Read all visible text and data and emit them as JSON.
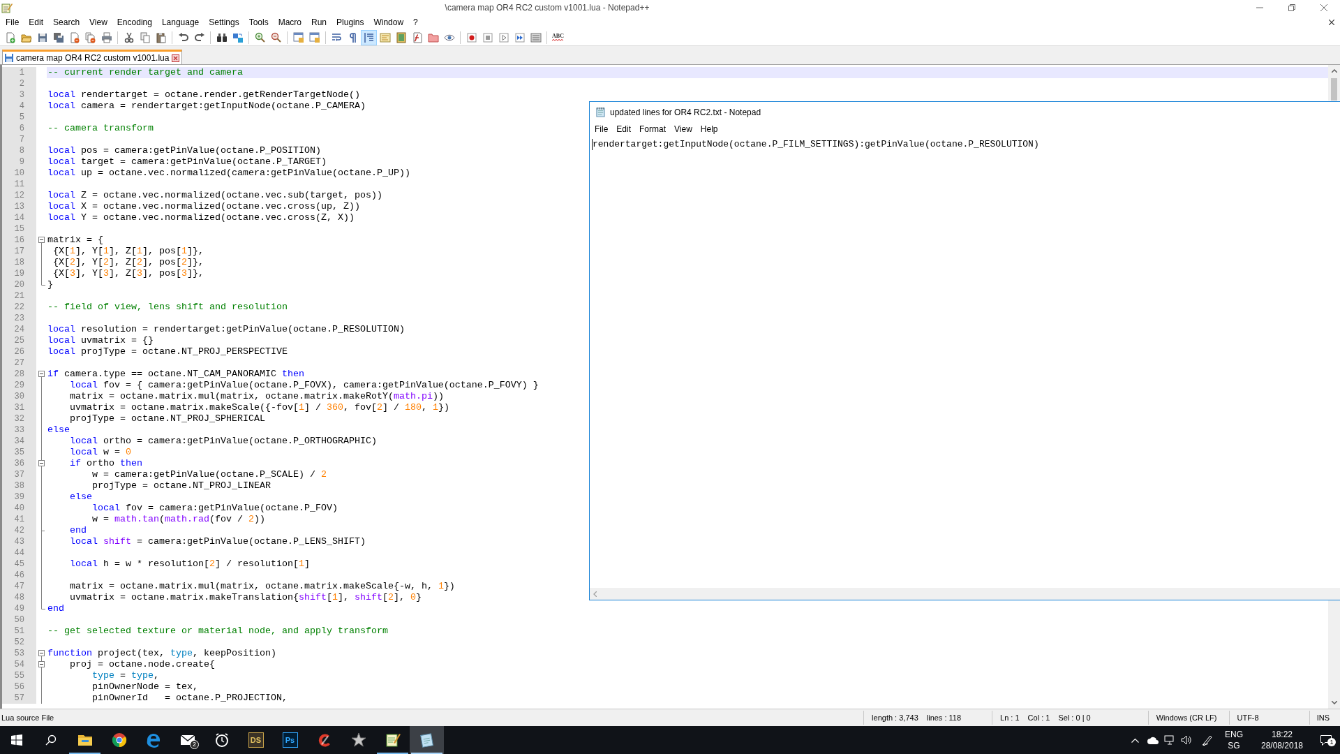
{
  "window": {
    "title": "\\camera map OR4 RC2 custom v1001.lua - Notepad++"
  },
  "menu": [
    "File",
    "Edit",
    "Search",
    "View",
    "Encoding",
    "Language",
    "Settings",
    "Tools",
    "Macro",
    "Run",
    "Plugins",
    "Window",
    "?"
  ],
  "toolbar": [
    {
      "kind": "new",
      "pressed": false
    },
    {
      "kind": "open",
      "pressed": false
    },
    {
      "kind": "save",
      "pressed": false
    },
    {
      "kind": "save_all",
      "pressed": false
    },
    {
      "kind": "close",
      "pressed": false
    },
    {
      "kind": "close_all",
      "pressed": false
    },
    {
      "kind": "print",
      "pressed": false
    },
    {
      "kind": "separator"
    },
    {
      "kind": "cut",
      "pressed": false
    },
    {
      "kind": "copy",
      "pressed": false
    },
    {
      "kind": "paste",
      "pressed": false
    },
    {
      "kind": "separator"
    },
    {
      "kind": "undo",
      "pressed": false
    },
    {
      "kind": "redo",
      "pressed": false
    },
    {
      "kind": "separator"
    },
    {
      "kind": "find",
      "pressed": false
    },
    {
      "kind": "replace",
      "pressed": false
    },
    {
      "kind": "separator"
    },
    {
      "kind": "zoom_in",
      "pressed": false
    },
    {
      "kind": "zoom_out",
      "pressed": false
    },
    {
      "kind": "separator"
    },
    {
      "kind": "sync_v",
      "pressed": false
    },
    {
      "kind": "sync_h",
      "pressed": false
    },
    {
      "kind": "separator"
    },
    {
      "kind": "wrap",
      "pressed": false
    },
    {
      "kind": "all_chars",
      "pressed": false
    },
    {
      "kind": "indent_guide",
      "pressed": true
    },
    {
      "kind": "udl",
      "pressed": false
    },
    {
      "kind": "doc_map",
      "pressed": false
    },
    {
      "kind": "func_list",
      "pressed": false
    },
    {
      "kind": "folder",
      "pressed": false
    },
    {
      "kind": "monitor",
      "pressed": false
    },
    {
      "kind": "separator"
    },
    {
      "kind": "record",
      "pressed": false
    },
    {
      "kind": "stop",
      "pressed": false
    },
    {
      "kind": "play",
      "pressed": false
    },
    {
      "kind": "play_multi",
      "pressed": false
    },
    {
      "kind": "save_macro",
      "pressed": false
    },
    {
      "kind": "separator"
    },
    {
      "kind": "spell",
      "pressed": false,
      "label": "ABC"
    }
  ],
  "tabs": [
    {
      "label": "camera map OR4 RC2 custom v1001.lua",
      "selected": true
    }
  ],
  "editor": {
    "lines": [
      {
        "number": "1",
        "current": true,
        "kind": "plain",
        "tokens": [
          {
            "kind": "comment",
            "text": "-- current render target and camera"
          }
        ]
      },
      {
        "number": "2",
        "current": false,
        "kind": "plain"
      },
      {
        "number": "3",
        "current": false,
        "kind": "plain",
        "tokens": [
          {
            "kind": "keyword",
            "text": "local"
          },
          {
            "kind": "plain",
            "text": " rendertarget = octane.render.getRenderTargetNode()"
          }
        ]
      },
      {
        "number": "4",
        "current": false,
        "kind": "plain",
        "tokens": [
          {
            "kind": "keyword",
            "text": "local"
          },
          {
            "kind": "plain",
            "text": " camera = rendertarget:getInputNode(octane.P_CAMERA)"
          }
        ]
      },
      {
        "number": "5",
        "current": false,
        "kind": "plain"
      },
      {
        "number": "6",
        "current": false,
        "kind": "plain",
        "tokens": [
          {
            "kind": "comment",
            "text": "-- camera transform"
          }
        ]
      },
      {
        "number": "7",
        "current": false,
        "kind": "plain"
      },
      {
        "number": "8",
        "current": false,
        "kind": "plain",
        "tokens": [
          {
            "kind": "keyword",
            "text": "local"
          },
          {
            "kind": "plain",
            "text": " pos = camera:getPinValue(octane.P_POSITION)"
          }
        ]
      },
      {
        "number": "9",
        "current": false,
        "kind": "plain",
        "tokens": [
          {
            "kind": "keyword",
            "text": "local"
          },
          {
            "kind": "plain",
            "text": " target = camera:getPinValue(octane.P_TARGET)"
          }
        ]
      },
      {
        "number": "10",
        "current": false,
        "kind": "plain",
        "tokens": [
          {
            "kind": "keyword",
            "text": "local"
          },
          {
            "kind": "plain",
            "text": " up = octane.vec.normalized(camera:getPinValue(octane.P_UP))"
          }
        ]
      },
      {
        "number": "11",
        "current": false,
        "kind": "plain"
      },
      {
        "number": "12",
        "current": false,
        "kind": "plain",
        "tokens": [
          {
            "kind": "keyword",
            "text": "local"
          },
          {
            "kind": "plain",
            "text": " Z = octane.vec.normalized(octane.vec.sub(target, pos))"
          }
        ]
      },
      {
        "number": "13",
        "current": false,
        "kind": "plain",
        "tokens": [
          {
            "kind": "keyword",
            "text": "local"
          },
          {
            "kind": "plain",
            "text": " X = octane.vec.normalized(octane.vec.cross(up, Z))"
          }
        ]
      },
      {
        "number": "14",
        "current": false,
        "kind": "plain",
        "tokens": [
          {
            "kind": "keyword",
            "text": "local"
          },
          {
            "kind": "plain",
            "text": " Y = octane.vec.normalized(octane.vec.cross(Z, X))"
          }
        ]
      },
      {
        "number": "15",
        "current": false,
        "kind": "plain"
      },
      {
        "number": "16",
        "current": false,
        "kind": "fold_start",
        "tokens": [
          {
            "kind": "plain",
            "text": "matrix = {"
          }
        ]
      },
      {
        "number": "17",
        "current": false,
        "kind": "fold_body",
        "tokens": [
          {
            "kind": "plain",
            "text": " {X["
          },
          {
            "kind": "number",
            "text": "1"
          },
          {
            "kind": "plain",
            "text": "], Y["
          },
          {
            "kind": "number",
            "text": "1"
          },
          {
            "kind": "plain",
            "text": "], Z["
          },
          {
            "kind": "number",
            "text": "1"
          },
          {
            "kind": "plain",
            "text": "], pos["
          },
          {
            "kind": "number",
            "text": "1"
          },
          {
            "kind": "plain",
            "text": "]},"
          }
        ]
      },
      {
        "number": "18",
        "current": false,
        "kind": "fold_body",
        "tokens": [
          {
            "kind": "plain",
            "text": " {X["
          },
          {
            "kind": "number",
            "text": "2"
          },
          {
            "kind": "plain",
            "text": "], Y["
          },
          {
            "kind": "number",
            "text": "2"
          },
          {
            "kind": "plain",
            "text": "], Z["
          },
          {
            "kind": "number",
            "text": "2"
          },
          {
            "kind": "plain",
            "text": "], pos["
          },
          {
            "kind": "number",
            "text": "2"
          },
          {
            "kind": "plain",
            "text": "]},"
          }
        ]
      },
      {
        "number": "19",
        "current": false,
        "kind": "fold_body",
        "tokens": [
          {
            "kind": "plain",
            "text": " {X["
          },
          {
            "kind": "number",
            "text": "3"
          },
          {
            "kind": "plain",
            "text": "], Y["
          },
          {
            "kind": "number",
            "text": "3"
          },
          {
            "kind": "plain",
            "text": "], Z["
          },
          {
            "kind": "number",
            "text": "3"
          },
          {
            "kind": "plain",
            "text": "], pos["
          },
          {
            "kind": "number",
            "text": "3"
          },
          {
            "kind": "plain",
            "text": "]},"
          }
        ]
      },
      {
        "number": "20",
        "current": false,
        "kind": "fold_end",
        "tokens": [
          {
            "kind": "plain",
            "text": "}"
          }
        ]
      },
      {
        "number": "21",
        "current": false,
        "kind": "plain"
      },
      {
        "number": "22",
        "current": false,
        "kind": "plain",
        "tokens": [
          {
            "kind": "comment",
            "text": "-- field of view, lens shift and resolution"
          }
        ]
      },
      {
        "number": "23",
        "current": false,
        "kind": "plain"
      },
      {
        "number": "24",
        "current": false,
        "kind": "plain",
        "tokens": [
          {
            "kind": "keyword",
            "text": "local"
          },
          {
            "kind": "plain",
            "text": " resolution = rendertarget:getPinValue(octane.P_RESOLUTION)"
          }
        ]
      },
      {
        "number": "25",
        "current": false,
        "kind": "plain",
        "tokens": [
          {
            "kind": "keyword",
            "text": "local"
          },
          {
            "kind": "plain",
            "text": " uvmatrix = {}"
          }
        ]
      },
      {
        "number": "26",
        "current": false,
        "kind": "plain",
        "tokens": [
          {
            "kind": "keyword",
            "text": "local"
          },
          {
            "kind": "plain",
            "text": " projType = octane.NT_PROJ_PERSPECTIVE"
          }
        ]
      },
      {
        "number": "27",
        "current": false,
        "kind": "plain"
      },
      {
        "number": "28",
        "current": false,
        "kind": "fold_start",
        "tokens": [
          {
            "kind": "keyword",
            "text": "if"
          },
          {
            "kind": "plain",
            "text": " camera.type == octane.NT_CAM_PANORAMIC "
          },
          {
            "kind": "keyword",
            "text": "then"
          }
        ]
      },
      {
        "number": "29",
        "current": false,
        "kind": "fold_body",
        "tokens": [
          {
            "kind": "keyword",
            "text": "    local"
          },
          {
            "kind": "plain",
            "text": " fov = { camera:getPinValue(octane.P_FOVX), camera:getPinValue(octane.P_FOVY) }"
          }
        ]
      },
      {
        "number": "30",
        "current": false,
        "kind": "fold_body",
        "tokens": [
          {
            "kind": "plain",
            "text": "    matrix = octane.matrix.mul(matrix, octane.matrix.makeRotY("
          },
          {
            "kind": "library",
            "text": "math.pi"
          },
          {
            "kind": "plain",
            "text": "))"
          }
        ]
      },
      {
        "number": "31",
        "current": false,
        "kind": "fold_body",
        "tokens": [
          {
            "kind": "plain",
            "text": "    uvmatrix = octane.matrix.makeScale({-fov["
          },
          {
            "kind": "number",
            "text": "1"
          },
          {
            "kind": "plain",
            "text": "] / "
          },
          {
            "kind": "number",
            "text": "360"
          },
          {
            "kind": "plain",
            "text": ", fov["
          },
          {
            "kind": "number",
            "text": "2"
          },
          {
            "kind": "plain",
            "text": "] / "
          },
          {
            "kind": "number",
            "text": "180"
          },
          {
            "kind": "plain",
            "text": ", "
          },
          {
            "kind": "number",
            "text": "1"
          },
          {
            "kind": "plain",
            "text": "})"
          }
        ]
      },
      {
        "number": "32",
        "current": false,
        "kind": "fold_body",
        "tokens": [
          {
            "kind": "plain",
            "text": "    projType = octane.NT_PROJ_SPHERICAL"
          }
        ]
      },
      {
        "number": "33",
        "current": false,
        "kind": "fold_body",
        "tokens": [
          {
            "kind": "keyword",
            "text": "else"
          }
        ]
      },
      {
        "number": "34",
        "current": false,
        "kind": "fold_body",
        "tokens": [
          {
            "kind": "keyword",
            "text": "    local"
          },
          {
            "kind": "plain",
            "text": " ortho = camera:getPinValue(octane.P_ORTHOGRAPHIC)"
          }
        ]
      },
      {
        "number": "35",
        "current": false,
        "kind": "fold_body",
        "tokens": [
          {
            "kind": "keyword",
            "text": "    local"
          },
          {
            "kind": "plain",
            "text": " w = "
          },
          {
            "kind": "number",
            "text": "0"
          }
        ]
      },
      {
        "number": "36",
        "current": false,
        "kind": "fold_inner_start",
        "tokens": [
          {
            "kind": "keyword",
            "text": "    if"
          },
          {
            "kind": "plain",
            "text": " ortho "
          },
          {
            "kind": "keyword",
            "text": "then"
          }
        ]
      },
      {
        "number": "37",
        "current": false,
        "kind": "fold_body",
        "tokens": [
          {
            "kind": "plain",
            "text": "        w = camera:getPinValue(octane.P_SCALE) / "
          },
          {
            "kind": "number",
            "text": "2"
          }
        ]
      },
      {
        "number": "38",
        "current": false,
        "kind": "fold_body",
        "tokens": [
          {
            "kind": "plain",
            "text": "        projType = octane.NT_PROJ_LINEAR"
          }
        ]
      },
      {
        "number": "39",
        "current": false,
        "kind": "fold_body",
        "tokens": [
          {
            "kind": "keyword",
            "text": "    else"
          }
        ]
      },
      {
        "number": "40",
        "current": false,
        "kind": "fold_body",
        "tokens": [
          {
            "kind": "keyword",
            "text": "        local"
          },
          {
            "kind": "plain",
            "text": " fov = camera:getPinValue(octane.P_FOV)"
          }
        ]
      },
      {
        "number": "41",
        "current": false,
        "kind": "fold_body",
        "tokens": [
          {
            "kind": "plain",
            "text": "        w = "
          },
          {
            "kind": "library",
            "text": "math.tan"
          },
          {
            "kind": "plain",
            "text": "("
          },
          {
            "kind": "library",
            "text": "math.rad"
          },
          {
            "kind": "plain",
            "text": "(fov / "
          },
          {
            "kind": "number",
            "text": "2"
          },
          {
            "kind": "plain",
            "text": "))"
          }
        ]
      },
      {
        "number": "42",
        "current": false,
        "kind": "fold_inner_end",
        "tokens": [
          {
            "kind": "keyword",
            "text": "    end"
          }
        ]
      },
      {
        "number": "43",
        "current": false,
        "kind": "fold_body",
        "tokens": [
          {
            "kind": "keyword",
            "text": "    local"
          },
          {
            "kind": "library",
            "text": " shift"
          },
          {
            "kind": "plain",
            "text": " = camera:getPinValue(octane.P_LENS_SHIFT)"
          }
        ]
      },
      {
        "number": "44",
        "current": false,
        "kind": "fold_body"
      },
      {
        "number": "45",
        "current": false,
        "kind": "fold_body",
        "tokens": [
          {
            "kind": "keyword",
            "text": "    local"
          },
          {
            "kind": "plain",
            "text": " h = w * resolution["
          },
          {
            "kind": "number",
            "text": "2"
          },
          {
            "kind": "plain",
            "text": "] / resolution["
          },
          {
            "kind": "number",
            "text": "1"
          },
          {
            "kind": "plain",
            "text": "]"
          }
        ]
      },
      {
        "number": "46",
        "current": false,
        "kind": "fold_body"
      },
      {
        "number": "47",
        "current": false,
        "kind": "fold_body",
        "tokens": [
          {
            "kind": "plain",
            "text": "    matrix = octane.matrix.mul(matrix, octane.matrix.makeScale{-w, h, "
          },
          {
            "kind": "number",
            "text": "1"
          },
          {
            "kind": "plain",
            "text": "})"
          }
        ]
      },
      {
        "number": "48",
        "current": false,
        "kind": "fold_body",
        "tokens": [
          {
            "kind": "plain",
            "text": "    uvmatrix = octane.matrix.makeTranslation{"
          },
          {
            "kind": "library",
            "text": "shift"
          },
          {
            "kind": "plain",
            "text": "["
          },
          {
            "kind": "number",
            "text": "1"
          },
          {
            "kind": "plain",
            "text": "], "
          },
          {
            "kind": "library",
            "text": "shift"
          },
          {
            "kind": "plain",
            "text": "["
          },
          {
            "kind": "number",
            "text": "2"
          },
          {
            "kind": "plain",
            "text": "], "
          },
          {
            "kind": "number",
            "text": "0"
          },
          {
            "kind": "plain",
            "text": "}"
          }
        ]
      },
      {
        "number": "49",
        "current": false,
        "kind": "fold_end",
        "tokens": [
          {
            "kind": "keyword",
            "text": "end"
          }
        ]
      },
      {
        "number": "50",
        "current": false,
        "kind": "plain"
      },
      {
        "number": "51",
        "current": false,
        "kind": "plain",
        "tokens": [
          {
            "kind": "comment",
            "text": "-- get selected texture or material node, and apply transform"
          }
        ]
      },
      {
        "number": "52",
        "current": false,
        "kind": "plain"
      },
      {
        "number": "53",
        "current": false,
        "kind": "fold_start",
        "tokens": [
          {
            "kind": "keyword",
            "text": "function"
          },
          {
            "kind": "plain",
            "text": " project(tex, "
          },
          {
            "kind": "type",
            "text": "type"
          },
          {
            "kind": "plain",
            "text": ", keepPosition)"
          }
        ]
      },
      {
        "number": "54",
        "current": false,
        "kind": "fold_inner_start",
        "tokens": [
          {
            "kind": "plain",
            "text": "    proj = octane.node.create{"
          }
        ]
      },
      {
        "number": "55",
        "current": false,
        "kind": "fold_body",
        "tokens": [
          {
            "kind": "type",
            "text": "        type"
          },
          {
            "kind": "plain",
            "text": " = "
          },
          {
            "kind": "type",
            "text": "type"
          },
          {
            "kind": "plain",
            "text": ","
          }
        ]
      },
      {
        "number": "56",
        "current": false,
        "kind": "fold_body",
        "tokens": [
          {
            "kind": "plain",
            "text": "        pinOwnerNode = tex,"
          }
        ]
      },
      {
        "number": "57",
        "current": false,
        "kind": "fold_body",
        "tokens": [
          {
            "kind": "plain",
            "text": "        pinOwnerId   = octane.P_PROJECTION,"
          }
        ]
      }
    ]
  },
  "notepad": {
    "title": "updated lines for OR4 RC2.txt - Notepad",
    "menu": [
      "File",
      "Edit",
      "Format",
      "View",
      "Help"
    ],
    "text": "rendertarget:getInputNode(octane.P_FILM_SETTINGS):getPinValue(octane.P_RESOLUTION)"
  },
  "status_bar": {
    "file_type": "Lua source File",
    "length": "length : 3,743",
    "lines": "lines : 118",
    "ln": "Ln : 1",
    "col": "Col : 1",
    "sel": "Sel : 0 | 0",
    "eol": "Windows (CR LF)",
    "encoding": "UTF-8",
    "mode": "INS"
  },
  "taskbar": {
    "apps": [
      {
        "kind": "explorer",
        "running": true,
        "selected": false
      },
      {
        "kind": "chrome",
        "running": false,
        "selected": false
      },
      {
        "kind": "edge",
        "running": false,
        "selected": false
      },
      {
        "kind": "mail",
        "running": false,
        "selected": false,
        "badge": "2"
      },
      {
        "kind": "clock",
        "running": false,
        "selected": false
      },
      {
        "kind": "ds",
        "running": false,
        "selected": false,
        "label": "DS"
      },
      {
        "kind": "ps",
        "running": false,
        "selected": false,
        "label": "Ps"
      },
      {
        "kind": "cleaner",
        "running": false,
        "selected": false
      },
      {
        "kind": "star",
        "running": false,
        "selected": false
      },
      {
        "kind": "notepadpp",
        "running": true,
        "selected": false
      },
      {
        "kind": "notepad",
        "running": true,
        "selected": true
      }
    ],
    "language": "ENG",
    "region": "SG",
    "time": "18:22",
    "date": "28/08/2018",
    "notifications": "1"
  }
}
